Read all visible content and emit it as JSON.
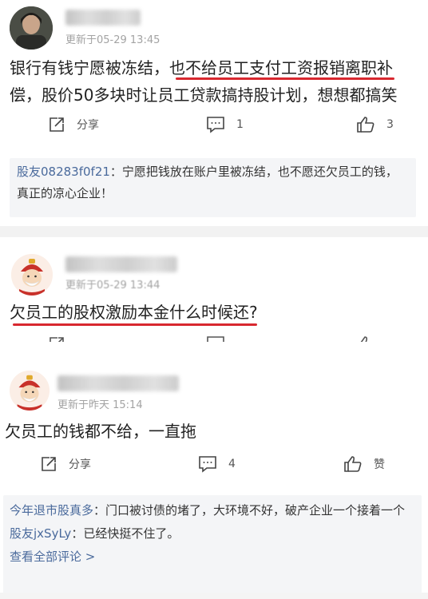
{
  "posts": [
    {
      "time": "更新于05-29 13:45",
      "text_before": "银行有钱宁愿被冻结，",
      "text_highlight": "也不给员工支付工资报销离职",
      "text_after": "补偿，股价50多块时让员工贷款搞持股计划，想想都搞笑",
      "share_label": "分享",
      "comment_count": "1",
      "like_count": "3",
      "replies": [
        {
          "user": "股友08283f0f21",
          "text": "：宁愿把钱放在账户里被冻结，也不愿还欠员工的钱，真正的凉心企业！"
        }
      ]
    },
    {
      "time": "更新于05-29 13:44",
      "text": "欠员工的股权激励本金什么时候还?"
    },
    {
      "time": "更新于昨天 15:14",
      "text": "欠员工的钱都不给，一直拖",
      "share_label": "分享",
      "comment_count": "4",
      "like_label": "赞",
      "replies": [
        {
          "user": "今年退市股真多",
          "text": "：门口被讨债的堵了，大环境不好，破产企业一个接着一个"
        },
        {
          "user": "股友jxSyLy",
          "text": "：已经快挺不住了。"
        }
      ],
      "view_all_label": "查看全部评论 >"
    }
  ],
  "colors": {
    "highlight_underline": "#d8282f",
    "reply_user": "#4a6a9c",
    "reply_background": "#f4f5f7",
    "time_text": "#a3a3a3"
  }
}
